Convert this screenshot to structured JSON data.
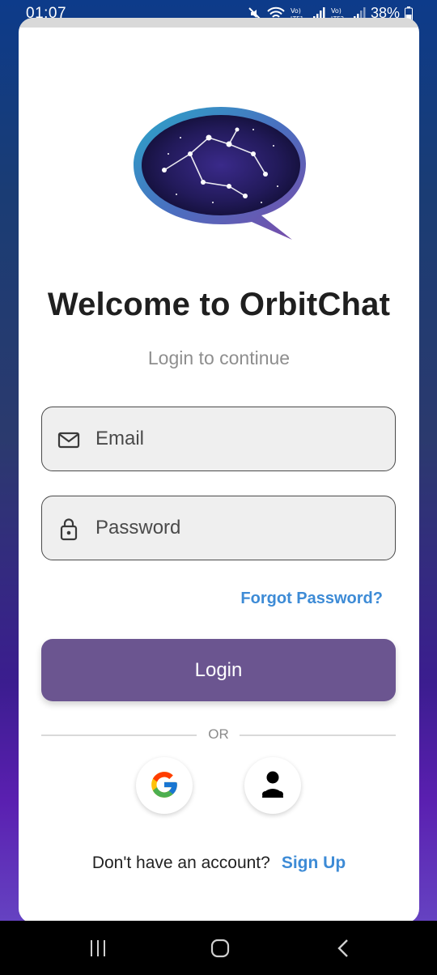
{
  "status_bar": {
    "time": "01:07",
    "battery": "38%",
    "icons": [
      "mute-icon",
      "wifi-icon",
      "volte-lte1-icon",
      "signal-icon",
      "volte-lte2-icon",
      "signal-icon",
      "battery-icon"
    ]
  },
  "header": {
    "logo_icon": "constellation-chat-bubble-logo",
    "title": "Welcome to OrbitChat",
    "subtitle": "Login to continue"
  },
  "form": {
    "email_placeholder": "Email",
    "email_icon": "mail-icon",
    "password_placeholder": "Password",
    "password_icon": "lock-icon",
    "forgot_password": "Forgot Password?",
    "login_label": "Login"
  },
  "divider": {
    "label": "OR"
  },
  "social": [
    {
      "name": "google",
      "icon": "google-icon"
    },
    {
      "name": "guest",
      "icon": "person-icon"
    }
  ],
  "footer": {
    "prompt": "Don't have an account?",
    "signup_label": "Sign Up"
  },
  "colors": {
    "primary": "#6b5590",
    "link": "#3d8bd6",
    "field_bg": "#efefef",
    "title": "#1f1f1f"
  },
  "nav": {
    "icons": [
      "recent-apps-icon",
      "home-icon",
      "back-icon"
    ]
  }
}
